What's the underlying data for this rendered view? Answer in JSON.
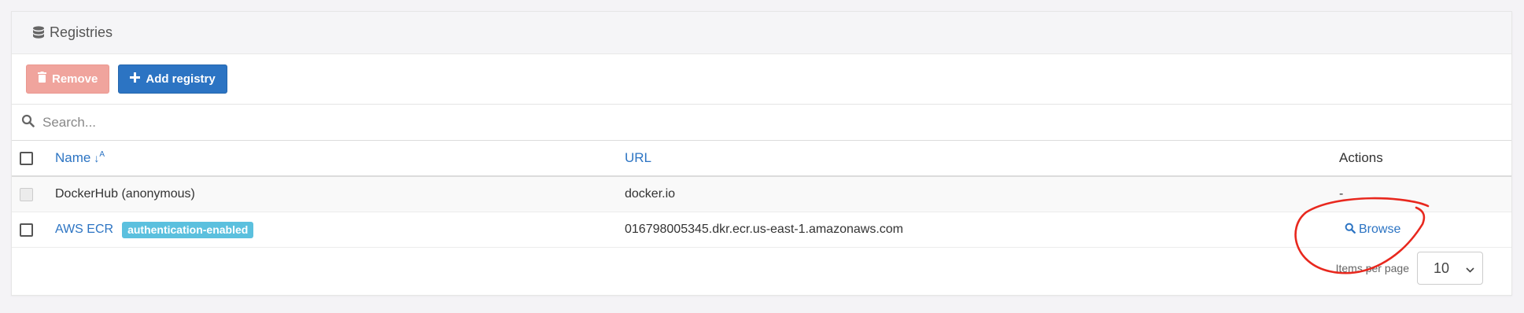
{
  "panel": {
    "title": "Registries",
    "title_icon": "database-icon"
  },
  "toolbar": {
    "remove_label": "Remove",
    "remove_icon": "trash-icon",
    "add_label": "Add registry",
    "add_icon": "plus-icon"
  },
  "search": {
    "placeholder": "Search...",
    "value": ""
  },
  "table": {
    "columns": {
      "name": "Name",
      "url": "URL",
      "actions": "Actions"
    },
    "rows": [
      {
        "name": "DockerHub (anonymous)",
        "url": "docker.io",
        "action": "-",
        "checkbox_disabled": true
      },
      {
        "name": "AWS ECR",
        "badge": "authentication-enabled",
        "url": "016798005345.dkr.ecr.us-east-1.amazonaws.com",
        "action": "Browse",
        "checkbox_disabled": false
      }
    ]
  },
  "pagination": {
    "label": "Items per page",
    "value": "10"
  },
  "colors": {
    "primary": "#2c74c3",
    "danger_disabled": "#f0a49d",
    "badge": "#5bc0de",
    "annotation": "#e8281e"
  }
}
